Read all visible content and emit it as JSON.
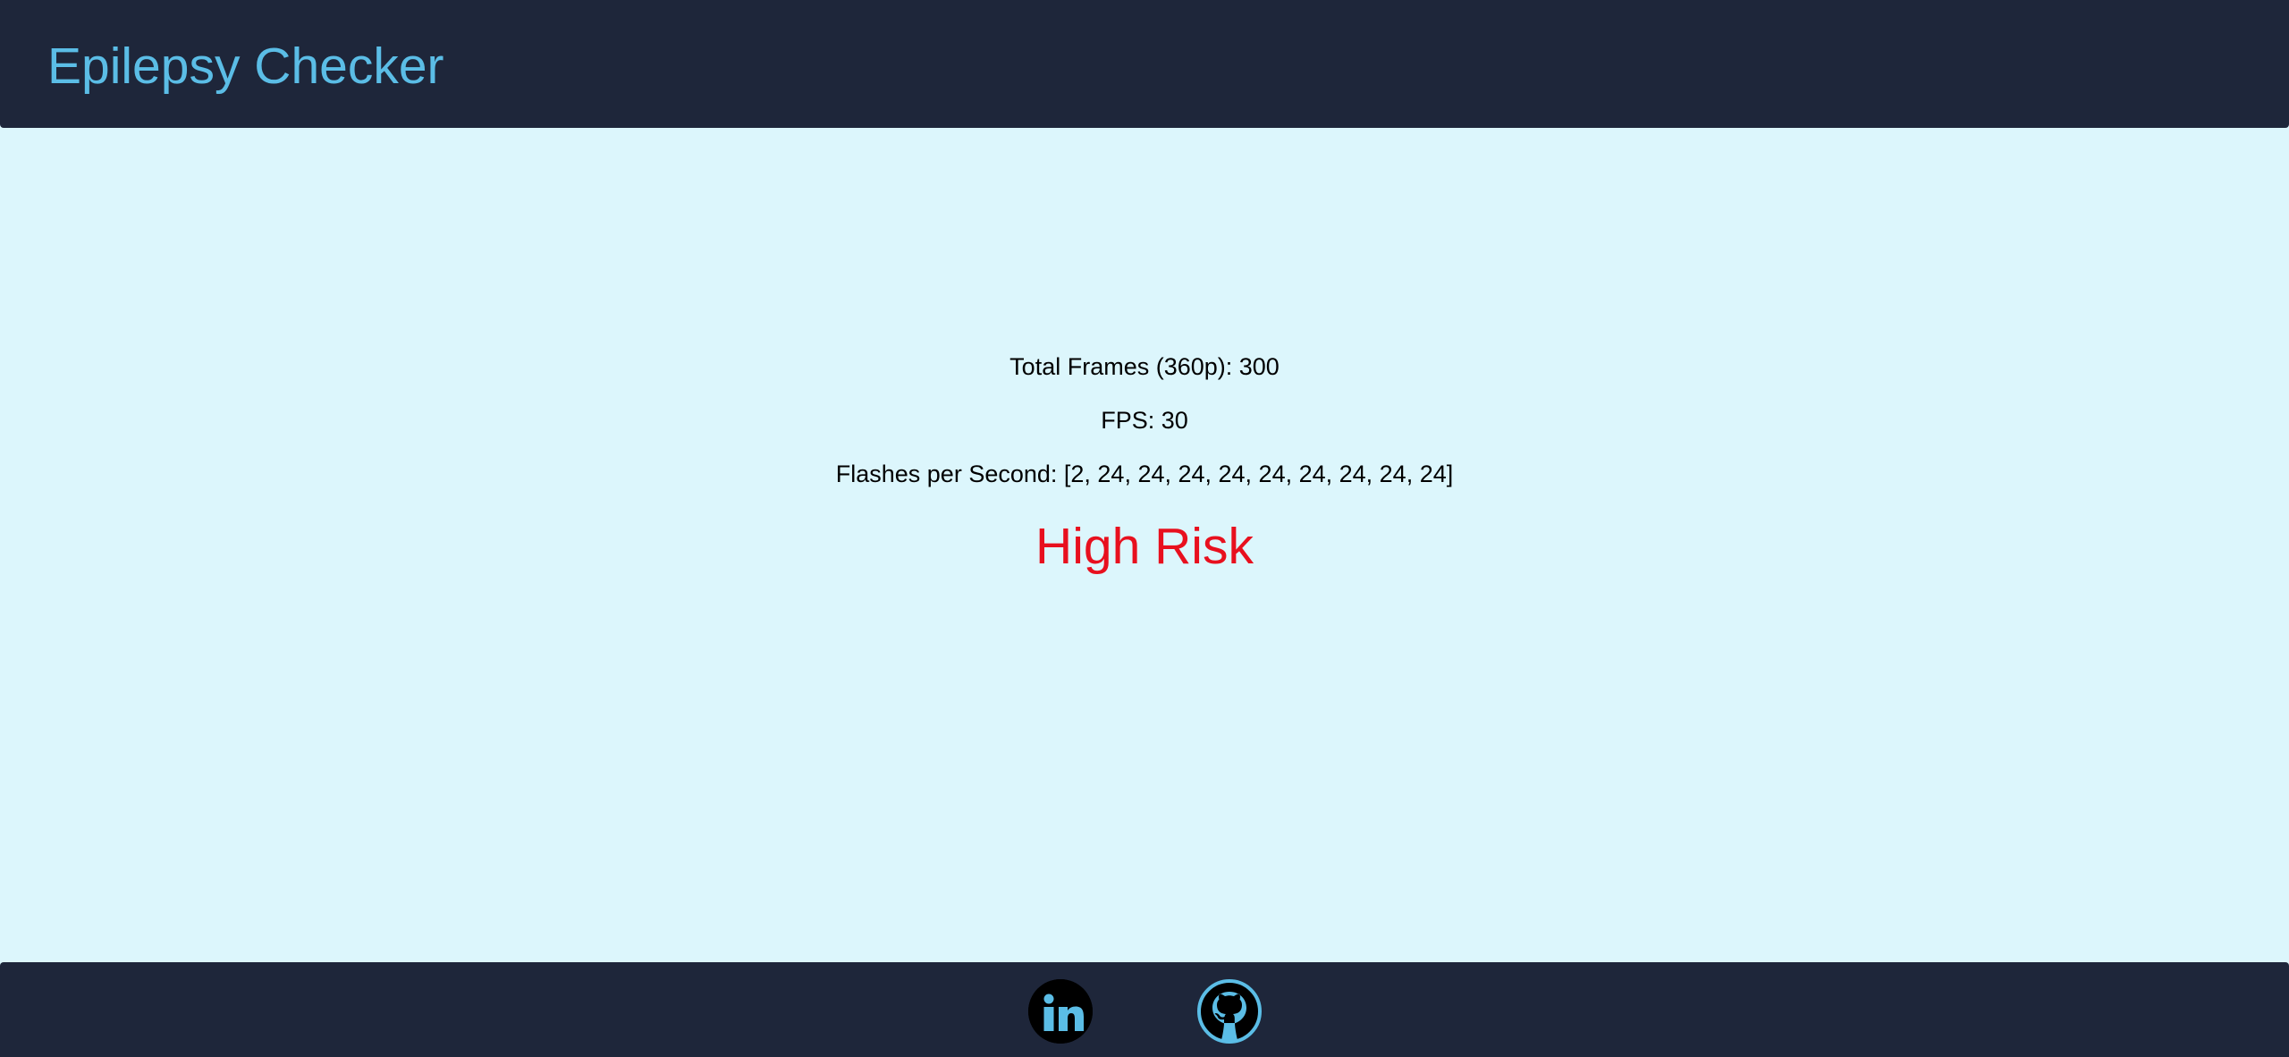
{
  "header": {
    "title": "Epilepsy Checker"
  },
  "results": {
    "total_frames_text": "Total Frames (360p): 300",
    "fps_text": "FPS: 30",
    "flashes_text": "Flashes per Second: [2, 24, 24, 24, 24, 24, 24, 24, 24, 24]",
    "risk_label": "High Risk"
  },
  "footer": {
    "links": [
      {
        "icon": "linkedin-icon"
      },
      {
        "icon": "github-icon"
      }
    ]
  },
  "colors": {
    "header_bg": "#1e263a",
    "title": "#5bbde6",
    "page_bg": "#dcf6fc",
    "risk_high": "#e8101e",
    "icon_accent": "#5bbde6"
  }
}
